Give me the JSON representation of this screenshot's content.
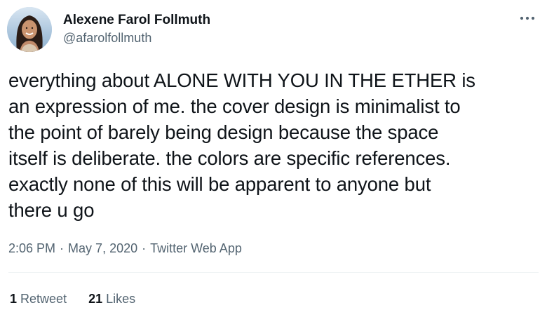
{
  "author": {
    "display_name": "Alexene Farol Follmuth",
    "handle": "@afarolfollmuth"
  },
  "more_icon": "more-horizontal-icon",
  "tweet_lines": [
    "everything about ALONE WITH YOU IN THE ETHER is",
    "an expression of me. the cover design is minimalist to",
    "the point of barely being design because the space",
    "itself is deliberate. the colors are specific references.",
    "exactly none of this will be apparent to anyone but",
    "there u go"
  ],
  "meta": {
    "time": "2:06 PM",
    "separator": "·",
    "date": "May 7, 2020",
    "source": "Twitter Web App"
  },
  "stats": {
    "retweets_count": "1",
    "retweets_label": "Retweet",
    "likes_count": "21",
    "likes_label": "Likes"
  },
  "colors": {
    "text_primary": "#0f1419",
    "text_secondary": "#536471",
    "divider": "#eff3f4"
  }
}
